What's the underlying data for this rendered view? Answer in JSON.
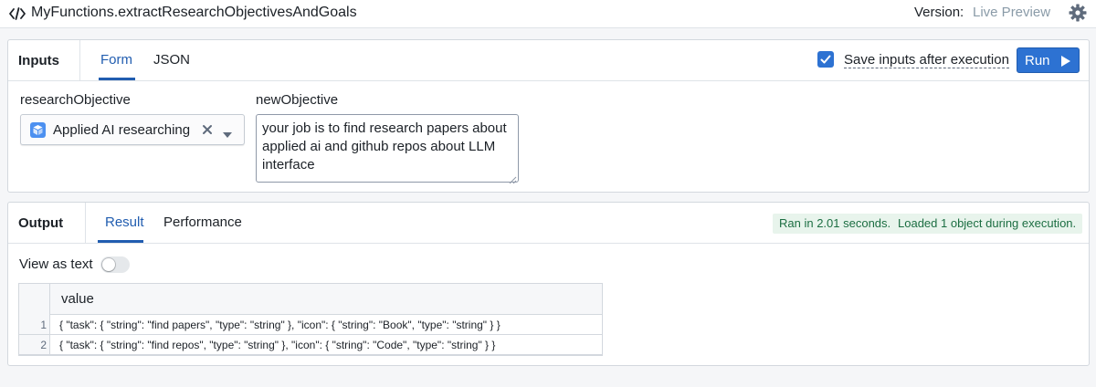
{
  "topbar": {
    "function_name": "MyFunctions.extractResearchObjectivesAndGoals",
    "version_label": "Version:",
    "version_value": "Live Preview"
  },
  "inputs": {
    "title": "Inputs",
    "tabs": [
      {
        "label": "Form",
        "active": true
      },
      {
        "label": "JSON",
        "active": false
      }
    ],
    "save_inputs_label": "Save inputs after execution",
    "save_inputs_checked": true,
    "run_label": "Run",
    "fields": {
      "research_objective": {
        "label": "researchObjective",
        "value": "Applied AI researching"
      },
      "new_objective": {
        "label": "newObjective",
        "value": "your job is to find research papers about applied ai and github repos about LLM interface"
      }
    }
  },
  "output": {
    "title": "Output",
    "tabs": [
      {
        "label": "Result",
        "active": true
      },
      {
        "label": "Performance",
        "active": false
      }
    ],
    "badges": [
      "Ran in 2.01 seconds.",
      "Loaded 1 object during execution."
    ],
    "view_as_text_label": "View as text",
    "view_as_text_on": false,
    "table": {
      "column": "value",
      "rows": [
        {
          "n": "1",
          "value": "{ \"task\": { \"string\": \"find papers\", \"type\": \"string\" }, \"icon\": { \"string\": \"Book\", \"type\": \"string\" } }"
        },
        {
          "n": "2",
          "value": "{ \"task\": { \"string\": \"find repos\", \"type\": \"string\" }, \"icon\": { \"string\": \"Code\", \"type\": \"string\" } }"
        }
      ]
    }
  },
  "colors": {
    "accent": "#2d72d2",
    "success_bg": "#e8f4ec",
    "success_text": "#1c6e42"
  },
  "icons": [
    "code-icon",
    "gear-icon",
    "checkmark-icon",
    "play-icon",
    "object-icon",
    "clear-icon",
    "caret-down-icon"
  ]
}
